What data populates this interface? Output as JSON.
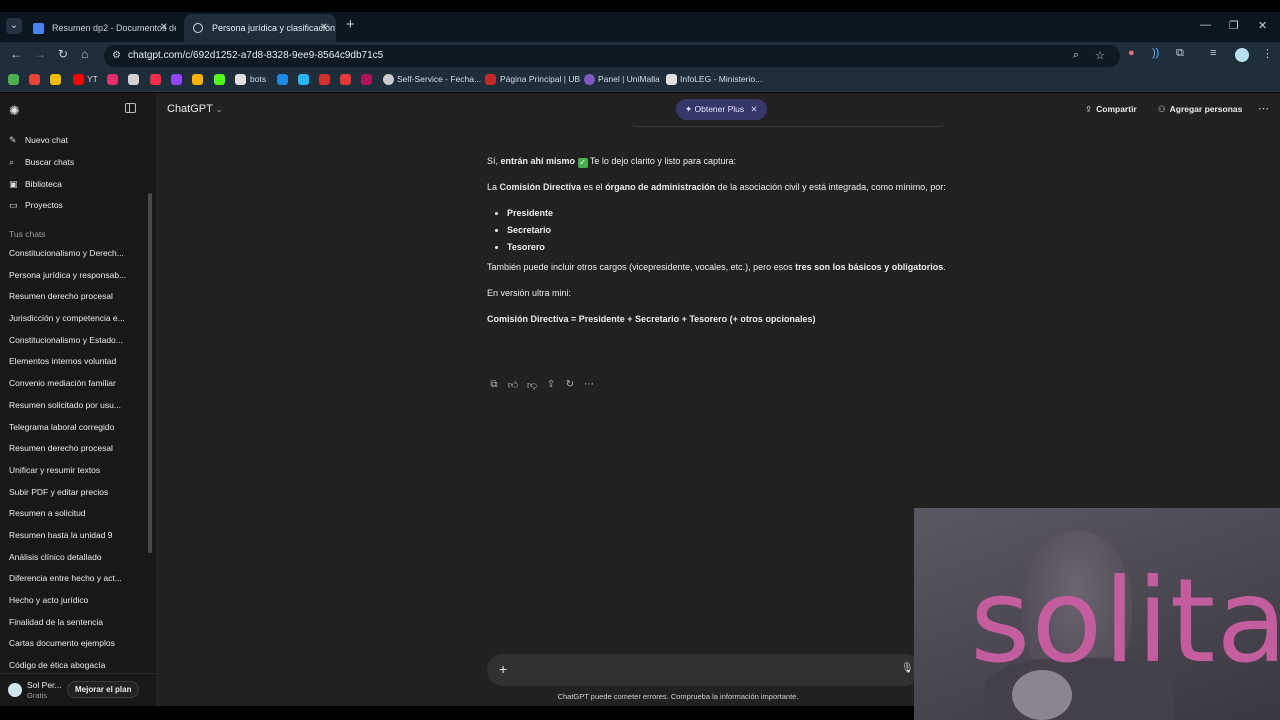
{
  "browser": {
    "tabs": [
      {
        "title": "Resumen dp2 - Documentos de",
        "active": false
      },
      {
        "title": "Persona jurídica y clasificación",
        "active": true
      }
    ],
    "url": "chatgpt.com/c/692d1252-a7d8-8328-9ee9-8564c9db71c5",
    "bookmarks": [
      {
        "icon": "youtube-icon",
        "label": "YT",
        "color": "#ff0000"
      },
      {
        "icon": "bots-icon",
        "label": "bots",
        "color": "#e0e0e0"
      },
      {
        "icon": "self-service-icon",
        "label": "Self-Service - Fecha...",
        "color": "#cccccc"
      },
      {
        "icon": "ub-icon",
        "label": "Página Principal | UB",
        "color": "#c62828"
      },
      {
        "icon": "unimalla-icon",
        "label": "Panel | UniMalla",
        "color": "#7e57c2"
      },
      {
        "icon": "infoleg-icon",
        "label": "InfoLEG - Ministerio...",
        "color": "#e0e0e0"
      }
    ]
  },
  "sidebar": {
    "actions": [
      {
        "icon": "edit-icon",
        "label": "Nuevo chat"
      },
      {
        "icon": "search-icon",
        "label": "Buscar chats"
      },
      {
        "icon": "library-icon",
        "label": "Biblioteca"
      },
      {
        "icon": "folder-icon",
        "label": "Proyectos"
      }
    ],
    "section_title": "Tus chats",
    "chats": [
      "Constitucionalismo y Derech...",
      "Persona jurídica y responsab...",
      "Resumen derecho procesal",
      "Jurisdicción y competencia e...",
      "Constitucionalismo y Estado...",
      "Elementos internos voluntad",
      "Convenio mediación familiar",
      "Resumen solicitado por usu...",
      "Telegrama laboral corregido",
      "Resumen derecho procesal",
      "Unificar y resumir textos",
      "Subir PDF y editar precios",
      "Resumen a solicitud",
      "Resumen hasta la unidad 9",
      "Análisis clínico detallado",
      "Diferencia entre hecho y act...",
      "Hecho y acto jurídico",
      "Finalidad de la sentencia",
      "Cartas documento ejemplos",
      "Código de ética abogacía"
    ],
    "user": {
      "name": "Sol Per...",
      "plan": "Gratis",
      "upgrade_label": "Mejorar el plan"
    }
  },
  "header": {
    "model": "ChatGPT",
    "plus_pill": "Obtener Plus",
    "share": "Compartir",
    "add_people": "Agregar personas"
  },
  "message": {
    "intro_pre": "Sí, ",
    "intro_bold": "entrán ahí mismo",
    "intro_post": " Te lo dejo clarito y listo para captura:",
    "p1_a": "La ",
    "p1_b": "Comisión Directiva",
    "p1_c": " es el ",
    "p1_d": "órgano de administración",
    "p1_e": " de la asociación civil y está integrada, como mínimo, por:",
    "list": [
      "Presidente",
      "Secretario",
      "Tesorero"
    ],
    "p2_a": "También puede incluir otros cargos (vicepresidente, vocales, etc.), pero esos ",
    "p2_b": "tres son los básicos y obligatorios",
    "p2_c": ".",
    "p3": "En versión ultra mini:",
    "p4": "Comisión Directiva = Presidente + Secretario + Tesorero (+ otros opcionales)"
  },
  "composer": {
    "disclaimer": "ChatGPT puede cometer errores. Comprueba la información importante."
  },
  "webcam": {
    "caption": "solita"
  }
}
